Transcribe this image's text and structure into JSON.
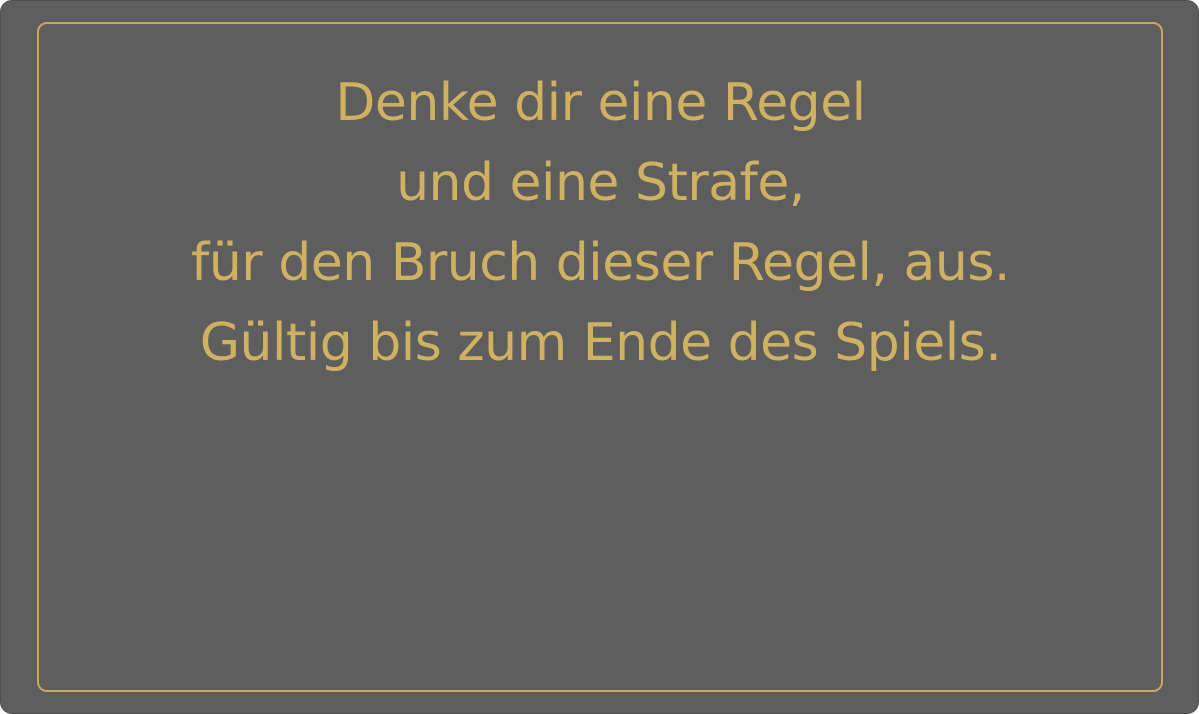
{
  "card": {
    "text_lines": [
      "Denke dir eine Regel",
      "und eine Strafe,",
      "für den Bruch dieser Regel, aus.",
      "Gültig bis zum Ende des Spiels."
    ]
  },
  "colors": {
    "background": "#5e5e5e",
    "accent": "#d0b162",
    "frame": "#c9a85c"
  }
}
